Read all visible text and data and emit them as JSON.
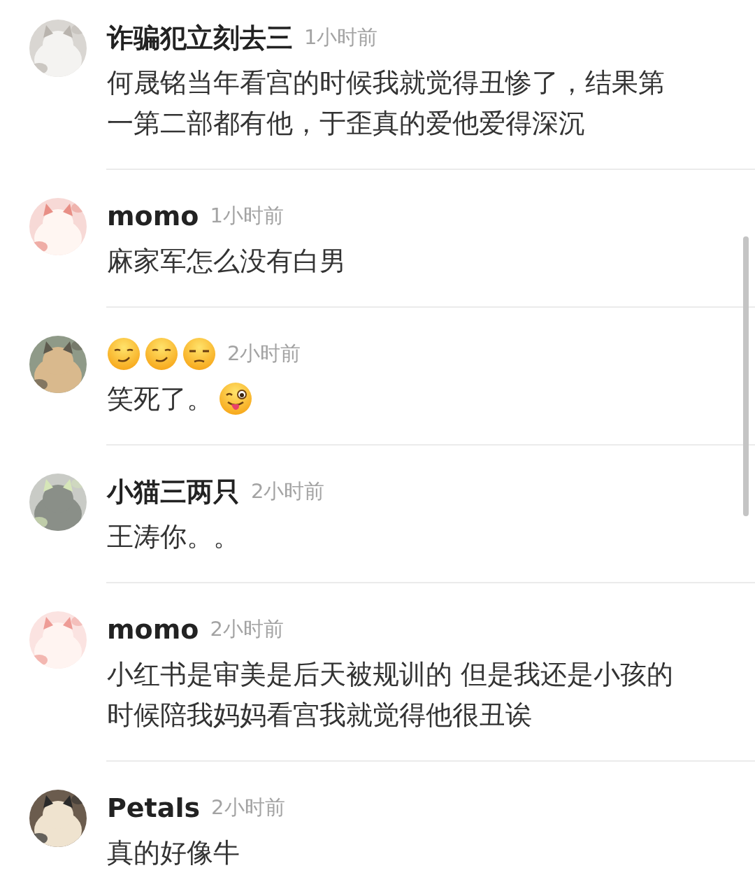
{
  "comments": [
    {
      "name": "诈骗犯立刻去三",
      "time": "1小时前",
      "text": "何晟铭当年看宫的时候我就觉得丑惨了，结果第一第二部都有他，于歪真的爱他爱得深沉"
    },
    {
      "name": "momo",
      "time": "1小时前",
      "text": "麻家军怎么没有白男"
    },
    {
      "name_icons": [
        {
          "kind": "smirk"
        },
        {
          "kind": "smirk"
        },
        {
          "kind": "unamused"
        }
      ],
      "time": "2小时前",
      "text": "笑死了。",
      "text_icons": [
        {
          "kind": "wink-tongue"
        }
      ]
    },
    {
      "name": "小猫三两只",
      "time": "2小时前",
      "text": "王涛你。。"
    },
    {
      "name": "momo",
      "time": "2小时前",
      "text": "小红书是审美是后天被规训的 但是我还是小孩的时候陪我妈妈看宫我就觉得他很丑诶"
    },
    {
      "name": "Petals",
      "time": "2小时前",
      "text": "真的好像牛"
    }
  ]
}
